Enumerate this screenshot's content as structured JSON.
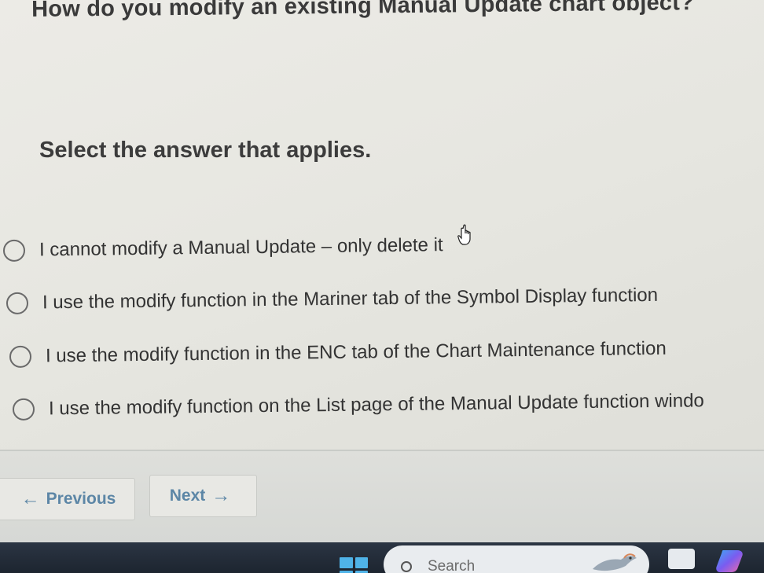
{
  "question": {
    "title": "How do you modify an existing Manual Update chart object?",
    "instruction": "Select the answer that applies."
  },
  "options": [
    {
      "label": "I cannot modify a Manual Update – only delete it",
      "selected": false
    },
    {
      "label": "I use the modify function in the Mariner tab of the Symbol Display function",
      "selected": false
    },
    {
      "label": "I use the modify function in the ENC tab of the Chart Maintenance function",
      "selected": false
    },
    {
      "label": "I use the modify function on the List page of the Manual Update function windo",
      "selected": false
    }
  ],
  "navigation": {
    "previous_label": "Previous",
    "next_label": "Next"
  },
  "taskbar": {
    "search_placeholder": "Search"
  },
  "colors": {
    "accent": "#5c86a6",
    "background": "#e6e6e0",
    "taskbar": "#1d2530",
    "start": "#4fb3e8"
  },
  "icons": [
    "hand-pointer-icon",
    "arrow-left-icon",
    "arrow-right-icon",
    "windows-start-icon",
    "search-icon",
    "task-view-icon",
    "copilot-icon"
  ]
}
